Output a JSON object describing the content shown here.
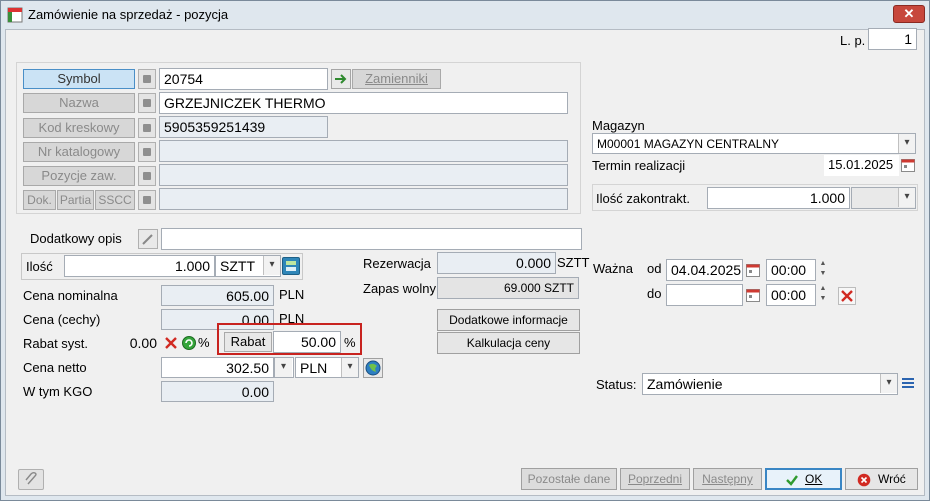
{
  "window": {
    "title": "Zamówienie na sprzedaż - pozycja",
    "close_label": "✕"
  },
  "lp": {
    "label": "L. p.",
    "value": "1"
  },
  "symbol": {
    "button": "Symbol",
    "value": "20754",
    "substitutes_button": "Zamienniki"
  },
  "nazwa": {
    "button": "Nazwa",
    "value": "GRZEJNICZEK THERMO"
  },
  "kod": {
    "button": "Kod kreskowy",
    "value": "5905359251439"
  },
  "katalog": {
    "button": "Nr katalogowy",
    "value": ""
  },
  "pozycje": {
    "button": "Pozycje zaw.",
    "value": ""
  },
  "dok": {
    "dok_label": "Dok.",
    "partia_label": "Partia",
    "sscc_label": "SSCC",
    "value": ""
  },
  "opis": {
    "label": "Dodatkowy opis",
    "value": ""
  },
  "ilosc": {
    "label": "Ilość",
    "value": "1.000",
    "unit": "SZTT"
  },
  "cena_nominalna": {
    "label": "Cena nominalna",
    "value": "605.00",
    "currency": "PLN"
  },
  "cena_cechy": {
    "label": "Cena (cechy)",
    "value": "0.00",
    "currency": "PLN"
  },
  "rabat_syst": {
    "label": "Rabat syst.",
    "value": "0.00",
    "percent": "%"
  },
  "rabat": {
    "label": "Rabat",
    "value": "50.00",
    "percent": "%"
  },
  "cena_netto": {
    "label": "Cena netto",
    "value": "302.50",
    "currency": "PLN"
  },
  "kgo": {
    "label": "W tym KGO",
    "value": "0.00"
  },
  "rezerwacja": {
    "label": "Rezerwacja",
    "value": "0.000",
    "unit": "SZTT"
  },
  "zapas": {
    "label": "Zapas wolny",
    "value": "69.000 SZTT"
  },
  "buttons": {
    "dodatkowe": "Dodatkowe informacje",
    "kalkulacja": "Kalkulacja ceny"
  },
  "magazyn": {
    "label": "Magazyn",
    "value": "M00001 MAGAZYN CENTRALNY"
  },
  "termin": {
    "label": "Termin realizacji",
    "value": "15.01.2025"
  },
  "ilosc_zakontr": {
    "label": "Ilość zakontrakt.",
    "value": "1.000"
  },
  "wazna": {
    "label": "Ważna",
    "od_label": "od",
    "do_label": "do",
    "od_date": "04.04.2025",
    "od_time": "00:00",
    "do_date": "",
    "do_time": "00:00"
  },
  "status": {
    "label": "Status:",
    "value": "Zamówienie"
  },
  "footer": {
    "pozostale": "Pozostałe dane",
    "poprzedni": "Poprzedni",
    "nastepny": "Następny",
    "ok": "OK",
    "wroc": "Wróć"
  },
  "colors": {
    "accent_red": "#c8231f",
    "ok_green": "#2f9a2f"
  },
  "icons": [
    "app-icon",
    "close-icon",
    "list-icon",
    "arrow-icon",
    "calculator-icon",
    "refresh-icon",
    "globe-icon",
    "calendar-icon",
    "clear-icon",
    "attach-icon",
    "check-icon",
    "cancel-icon",
    "status-list-icon"
  ]
}
